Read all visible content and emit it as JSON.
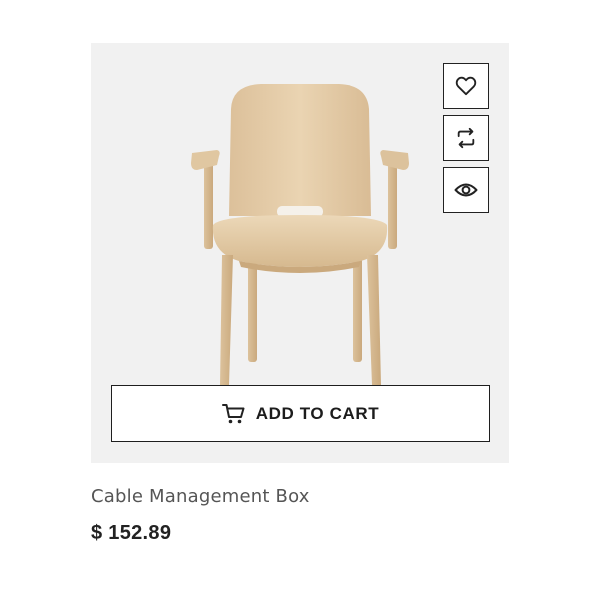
{
  "product": {
    "title": "Cable Management Box",
    "price": "$ 152.89",
    "image_alt": "wooden-armchair"
  },
  "actions": {
    "wishlist_icon": "heart-icon",
    "compare_icon": "compare-arrows-icon",
    "quickview_icon": "eye-icon"
  },
  "cart": {
    "label": "ADD TO CART",
    "icon": "cart-icon"
  },
  "colors": {
    "card_background": "#f1f1f1",
    "wood": "#e3c9a3",
    "text_dark": "#222222",
    "text_muted": "#555555"
  }
}
